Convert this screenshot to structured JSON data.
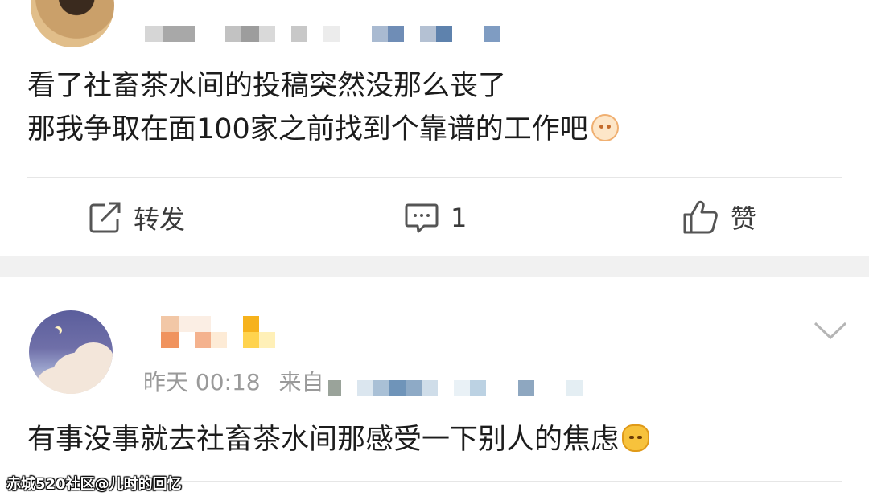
{
  "post1": {
    "text_line1": "看了社畜茶水间的投稿突然没那么丧了",
    "text_line2": "那我争取在面100家之前找到个靠谱的工作吧",
    "emoji": "sad-face-emoji",
    "actions": {
      "repost_label": "转发",
      "comment_count": "1",
      "like_label": "赞"
    }
  },
  "post2": {
    "time": "昨天 00:18",
    "source_prefix": "来自",
    "text": "有事没事就去社畜茶水间那感受一下别人的焦虑",
    "emoji": "cat-emoji"
  },
  "watermark": "赤城520社区@儿时的回忆",
  "icons": [
    "repost-icon",
    "comment-icon",
    "like-icon",
    "chevron-down-icon"
  ],
  "colors": {
    "text": "#1c1c1c",
    "meta": "#9a9a9a",
    "divider": "#e6e6e6",
    "band": "#f1f1f1"
  }
}
